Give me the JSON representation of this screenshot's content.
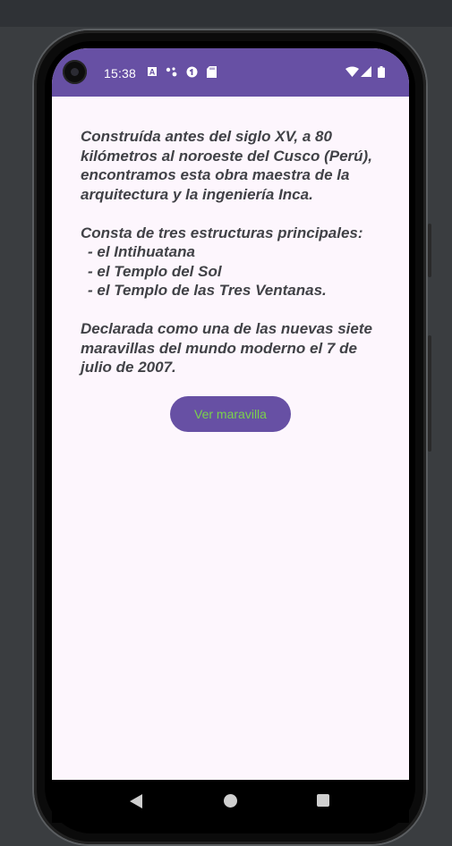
{
  "statusbar": {
    "time": "15:38",
    "icons": [
      "font-a-icon",
      "assistant-dots-icon",
      "sync-icon",
      "sd-card-icon",
      "wifi-icon",
      "signal-icon",
      "battery-icon"
    ]
  },
  "content": {
    "paragraph1": "Construída antes del siglo XV, a 80 kilómetros al noroeste del Cusco (Perú), encontramos esta obra maestra de la arquitectura y la ingeniería Inca.",
    "paragraph2_intro": "Consta de tres estructuras principales:",
    "structures": [
      "- el Intihuatana",
      "- el Templo del Sol",
      "- el Templo de las Tres Ventanas."
    ],
    "paragraph3": "Declarada como una de las nuevas siete maravillas del mundo moderno el 7 de julio de 2007."
  },
  "button": {
    "label": "Ver maravilla"
  },
  "colors": {
    "accent": "#6750a4",
    "button_text": "#7bd14c",
    "background": "#fdf6fd",
    "text": "#414247"
  }
}
